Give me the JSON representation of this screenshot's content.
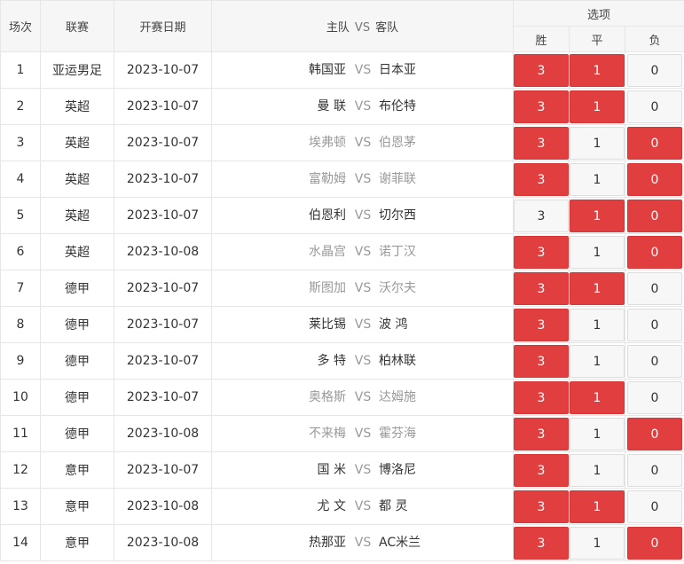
{
  "header": {
    "col_no": "场次",
    "col_league": "联赛",
    "col_date": "开赛日期",
    "col_home": "主队",
    "col_vs": "VS",
    "col_away": "客队",
    "col_options": "选项",
    "opt_win": "胜",
    "opt_draw": "平",
    "opt_lose": "负"
  },
  "vs_label": "VS",
  "colors": {
    "selected": "#e13f3f",
    "unselected": "#f7f7f7",
    "dim_text": "#999999"
  },
  "rows": [
    {
      "no": "1",
      "league": "亚运男足",
      "date": "2023-10-07",
      "home": "韩国亚",
      "away": "日本亚",
      "dim": false,
      "win": "3",
      "draw": "1",
      "lose": "0",
      "sel": [
        true,
        true,
        false
      ]
    },
    {
      "no": "2",
      "league": "英超",
      "date": "2023-10-07",
      "home": "曼 联",
      "away": "布伦特",
      "dim": false,
      "win": "3",
      "draw": "1",
      "lose": "0",
      "sel": [
        true,
        true,
        false
      ]
    },
    {
      "no": "3",
      "league": "英超",
      "date": "2023-10-07",
      "home": "埃弗顿",
      "away": "伯恩茅",
      "dim": true,
      "win": "3",
      "draw": "1",
      "lose": "0",
      "sel": [
        true,
        false,
        true
      ]
    },
    {
      "no": "4",
      "league": "英超",
      "date": "2023-10-07",
      "home": "富勒姆",
      "away": "谢菲联",
      "dim": true,
      "win": "3",
      "draw": "1",
      "lose": "0",
      "sel": [
        true,
        false,
        true
      ]
    },
    {
      "no": "5",
      "league": "英超",
      "date": "2023-10-07",
      "home": "伯恩利",
      "away": "切尔西",
      "dim": false,
      "win": "3",
      "draw": "1",
      "lose": "0",
      "sel": [
        false,
        true,
        true
      ]
    },
    {
      "no": "6",
      "league": "英超",
      "date": "2023-10-08",
      "home": "水晶宫",
      "away": "诺丁汉",
      "dim": true,
      "win": "3",
      "draw": "1",
      "lose": "0",
      "sel": [
        true,
        false,
        true
      ]
    },
    {
      "no": "7",
      "league": "德甲",
      "date": "2023-10-07",
      "home": "斯图加",
      "away": "沃尔夫",
      "dim": true,
      "win": "3",
      "draw": "1",
      "lose": "0",
      "sel": [
        true,
        true,
        false
      ]
    },
    {
      "no": "8",
      "league": "德甲",
      "date": "2023-10-07",
      "home": "莱比锡",
      "away": "波 鸿",
      "dim": false,
      "win": "3",
      "draw": "1",
      "lose": "0",
      "sel": [
        true,
        false,
        false
      ]
    },
    {
      "no": "9",
      "league": "德甲",
      "date": "2023-10-07",
      "home": "多 特",
      "away": "柏林联",
      "dim": false,
      "win": "3",
      "draw": "1",
      "lose": "0",
      "sel": [
        true,
        false,
        false
      ]
    },
    {
      "no": "10",
      "league": "德甲",
      "date": "2023-10-07",
      "home": "奥格斯",
      "away": "达姆施",
      "dim": true,
      "win": "3",
      "draw": "1",
      "lose": "0",
      "sel": [
        true,
        true,
        false
      ]
    },
    {
      "no": "11",
      "league": "德甲",
      "date": "2023-10-08",
      "home": "不来梅",
      "away": "霍芬海",
      "dim": true,
      "win": "3",
      "draw": "1",
      "lose": "0",
      "sel": [
        true,
        false,
        true
      ]
    },
    {
      "no": "12",
      "league": "意甲",
      "date": "2023-10-07",
      "home": "国 米",
      "away": "博洛尼",
      "dim": false,
      "win": "3",
      "draw": "1",
      "lose": "0",
      "sel": [
        true,
        false,
        false
      ]
    },
    {
      "no": "13",
      "league": "意甲",
      "date": "2023-10-08",
      "home": "尤 文",
      "away": "都 灵",
      "dim": false,
      "win": "3",
      "draw": "1",
      "lose": "0",
      "sel": [
        true,
        true,
        false
      ]
    },
    {
      "no": "14",
      "league": "意甲",
      "date": "2023-10-08",
      "home": "热那亚",
      "away": "AC米兰",
      "dim": false,
      "win": "3",
      "draw": "1",
      "lose": "0",
      "sel": [
        true,
        false,
        true
      ]
    }
  ]
}
